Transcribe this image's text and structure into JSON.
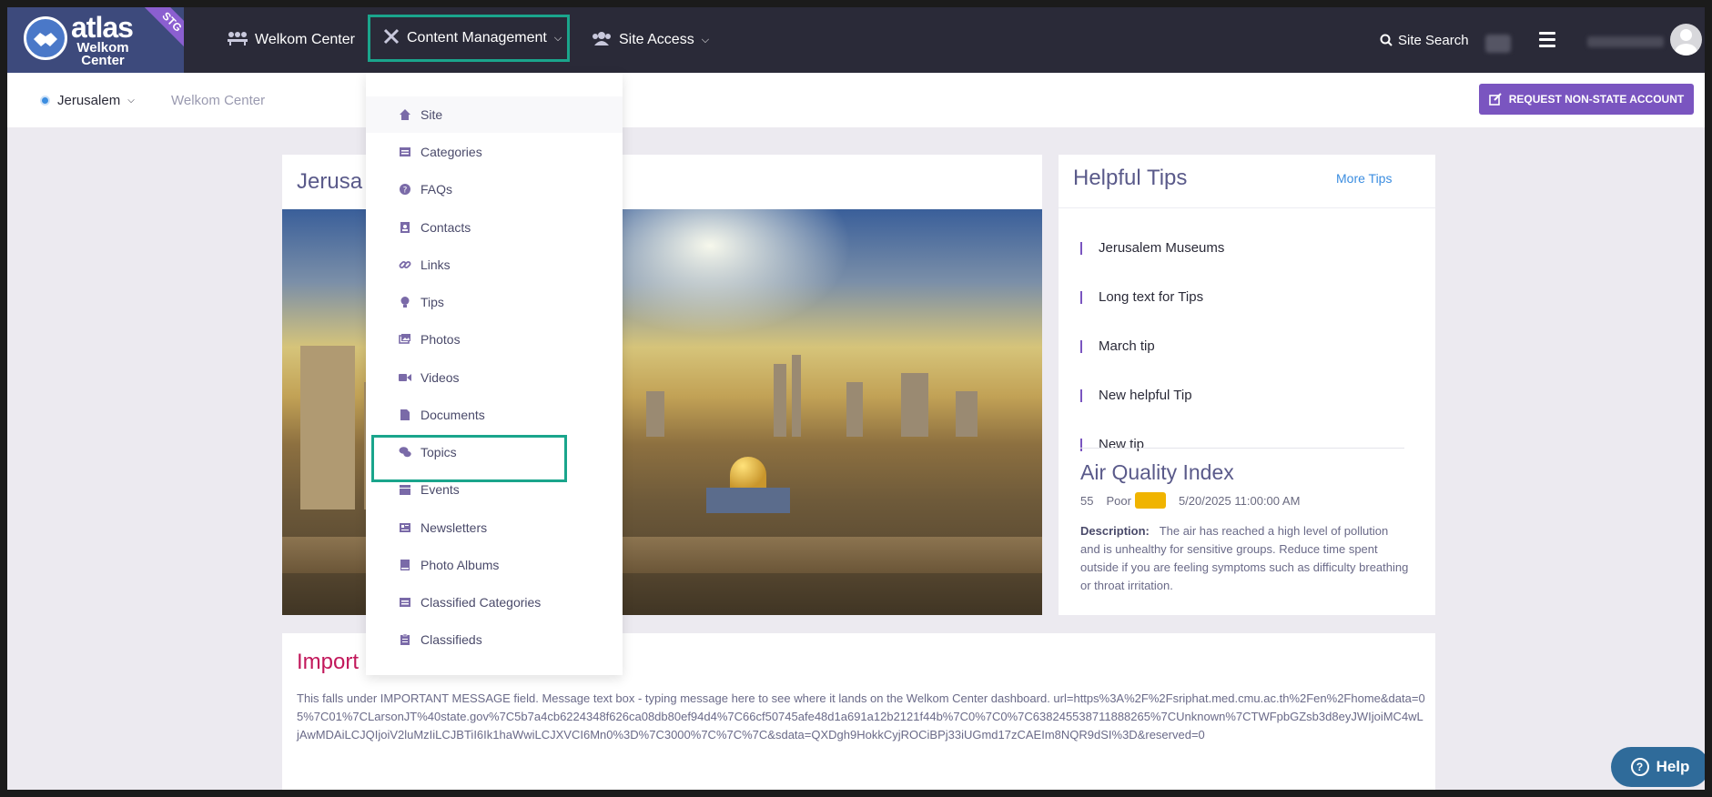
{
  "brand": {
    "name": "atlas",
    "subtitle": "Welkom Center",
    "env_badge": "STG"
  },
  "nav": {
    "welkom_center": "Welkom Center",
    "content_management": "Content Management",
    "site_access": "Site Access",
    "site_search": "Site Search"
  },
  "subbar": {
    "location": "Jerusalem",
    "breadcrumb": "Welkom Center",
    "request_button": "REQUEST NON-STATE ACCOUNT"
  },
  "dropdown": {
    "items": [
      {
        "label": "Site",
        "icon": "home-icon"
      },
      {
        "label": "Categories",
        "icon": "list-icon"
      },
      {
        "label": "FAQs",
        "icon": "question-icon"
      },
      {
        "label": "Contacts",
        "icon": "contact-icon"
      },
      {
        "label": "Links",
        "icon": "link-icon"
      },
      {
        "label": "Tips",
        "icon": "lightbulb-icon"
      },
      {
        "label": "Photos",
        "icon": "photos-icon"
      },
      {
        "label": "Videos",
        "icon": "video-icon"
      },
      {
        "label": "Documents",
        "icon": "document-icon"
      },
      {
        "label": "Topics",
        "icon": "comments-icon"
      },
      {
        "label": "Events",
        "icon": "calendar-icon"
      },
      {
        "label": "Newsletters",
        "icon": "newspaper-icon"
      },
      {
        "label": "Photo Albums",
        "icon": "book-icon"
      },
      {
        "label": "Classified Categories",
        "icon": "list-icon"
      },
      {
        "label": "Classifieds",
        "icon": "clipboard-icon"
      }
    ]
  },
  "hero": {
    "title": "Jerusa"
  },
  "tips": {
    "title": "Helpful Tips",
    "more": "More Tips",
    "items": [
      "Jerusalem Museums",
      "Long text for Tips",
      "March tip",
      "New helpful Tip",
      "New tip"
    ]
  },
  "aqi": {
    "title": "Air Quality Index",
    "value": "55",
    "status": "Poor",
    "status_color": "#f0b400",
    "timestamp": "5/20/2025 11:00:00 AM",
    "description_label": "Description:",
    "description": "The air has reached a high level of pollution and is unhealthy for sensitive groups. Reduce time spent outside if you are feeling symptoms such as difficulty breathing or throat irritation."
  },
  "important": {
    "title": "Import",
    "message": "This falls under IMPORTANT MESSAGE field. Message text box - typing message here to see where it lands on the Welkom Center dashboard. url=https%3A%2F%2Fsriphat.med.cmu.ac.th%2Fen%2Fhome&data=05%7C01%7CLarsonJT%40state.gov%7C5b7a4cb6224348f626ca08db80ef94d4%7C66cf50745afe48d1a691a12b2121f44b%7C0%7C0%7C638245538711888265%7CUnknown%7CTWFpbGZsb3d8eyJWIjoiMC4wLjAwMDAiLCJQIjoiV2luMzIiLCJBTiI6Ik1haWwiLCJXVCI6Mn0%3D%7C3000%7C%7C%7C&sdata=QXDgh9HokkCyjROCiBPj33iUGmd17zCAEIm8NQR9dSI%3D&reserved=0"
  },
  "help": {
    "label": "Help"
  },
  "colors": {
    "accent": "#7a55c0",
    "highlight": "#1aa58c",
    "topbar": "#2a2a38"
  }
}
